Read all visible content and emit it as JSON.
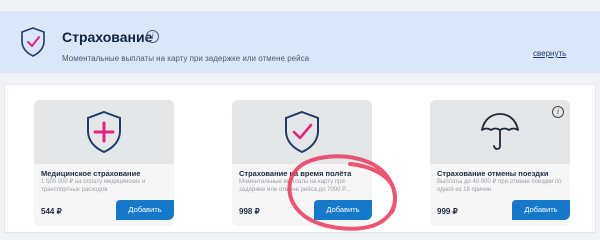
{
  "banner": {
    "title": "Страхование",
    "info_glyph": "i",
    "subtitle": "Моментальные выплаты на карту при задержке или отмене рейса",
    "collapse_label": "свернуть",
    "icon": "shield-check-icon"
  },
  "cards": [
    {
      "title": "Медицинское страхование",
      "description": "1 500 000 ₽ на оплату медицинских и транспортных расходов",
      "price": "544 ₽",
      "button_label": "Добавить",
      "icon": "shield-plus-icon"
    },
    {
      "title": "Страхование на время полёта",
      "description": "Моментальные выплаты на карту при задержке или отмене рейса до 7000 Р...",
      "price": "998 ₽",
      "button_label": "Добавить",
      "icon": "shield-check-icon"
    },
    {
      "title": "Страхование отмены поездки",
      "description": "Выплаты до 40 000 ₽ при отмене поездки по одной из 18 причин",
      "price": "999 ₽",
      "button_label": "Добавить",
      "icon": "umbrella-icon",
      "info_glyph": "i"
    }
  ],
  "colors": {
    "banner_bg": "#dbe7f9",
    "accent_pink": "#e2247a",
    "button_blue": "#1578c8",
    "annotation_red": "#e8385a"
  }
}
